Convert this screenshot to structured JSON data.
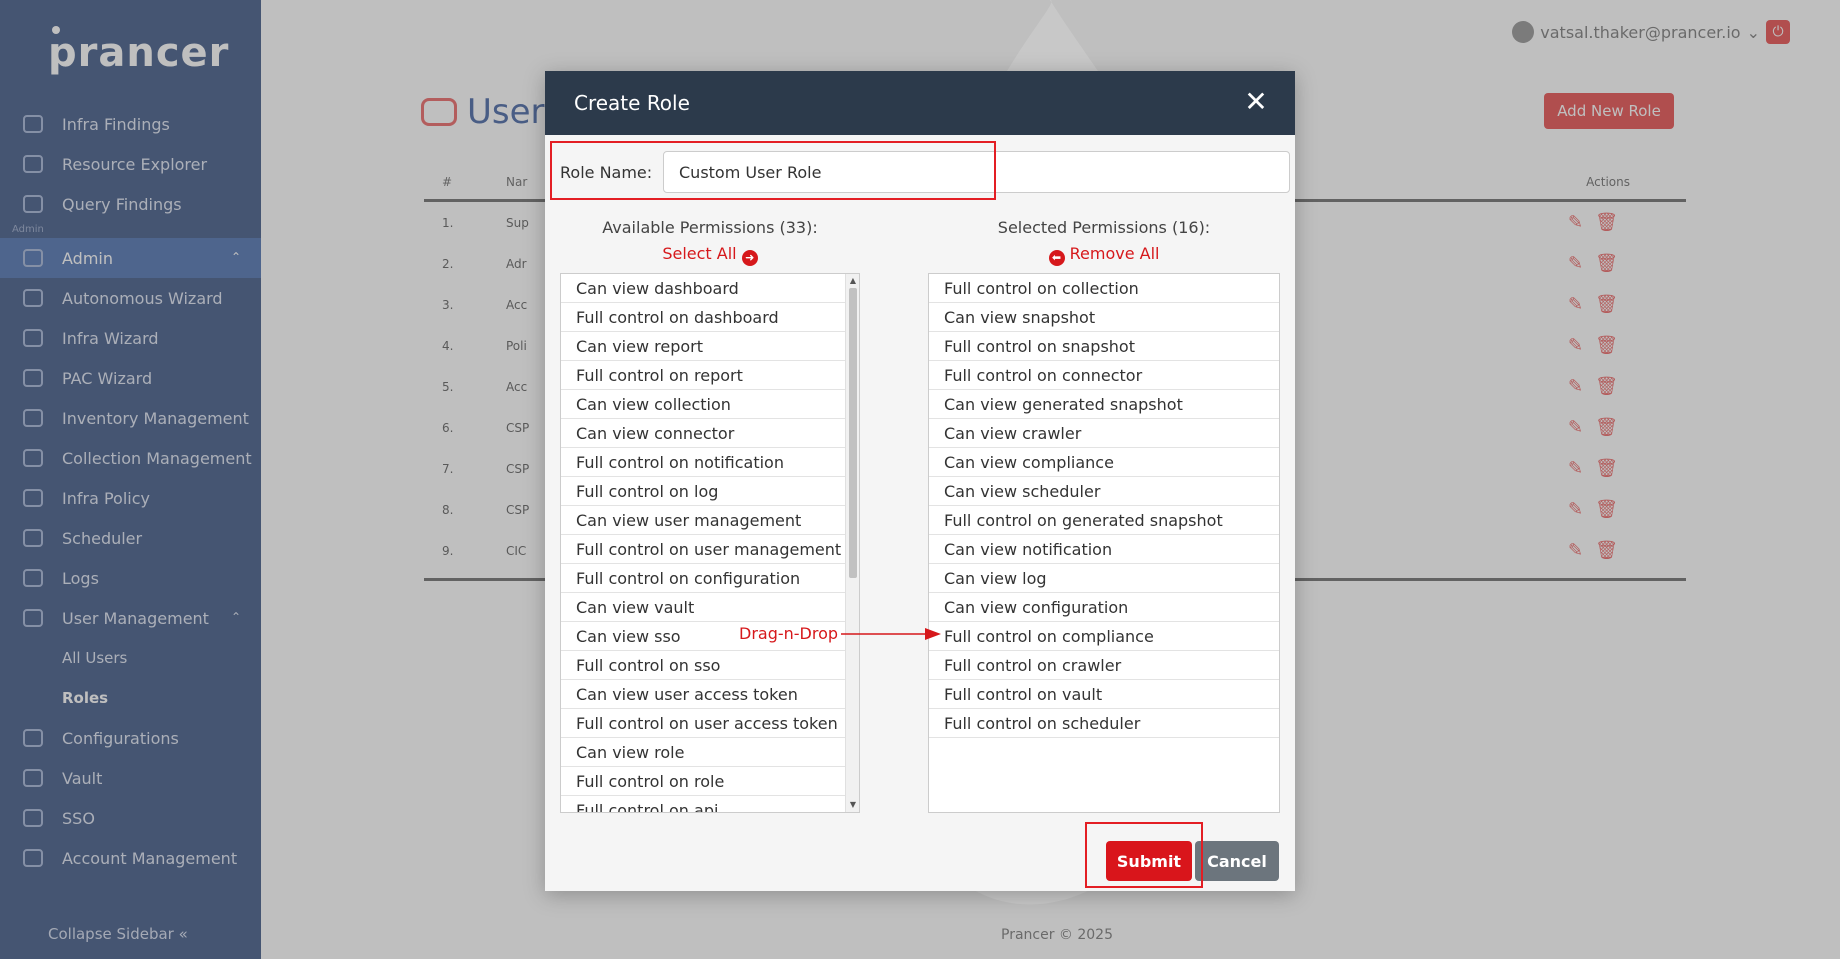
{
  "app": {
    "brand": "prancer",
    "footer": "Prancer © 2025"
  },
  "sidebar": {
    "items": [
      {
        "label": "Infra Findings",
        "icon": "infra-findings-icon"
      },
      {
        "label": "Resource Explorer",
        "icon": "resource-explorer-icon"
      },
      {
        "label": "Query Findings",
        "icon": "query-findings-icon"
      }
    ],
    "section_label": "Admin",
    "admin": {
      "label": "Admin",
      "icon": "admin-icon"
    },
    "admin_items": [
      {
        "label": "Autonomous Wizard",
        "icon": "autonomous-wizard-icon"
      },
      {
        "label": "Infra Wizard",
        "icon": "infra-wizard-icon"
      },
      {
        "label": "PAC Wizard",
        "icon": "pac-wizard-icon"
      },
      {
        "label": "Inventory Management",
        "icon": "inventory-icon"
      },
      {
        "label": "Collection Management",
        "icon": "collection-icon"
      },
      {
        "label": "Infra Policy",
        "icon": "infra-policy-icon"
      },
      {
        "label": "Scheduler",
        "icon": "scheduler-icon"
      },
      {
        "label": "Logs",
        "icon": "logs-icon"
      }
    ],
    "user_management": {
      "label": "User Management",
      "icon": "user-management-icon"
    },
    "user_management_sub": [
      "All Users",
      "Roles"
    ],
    "more_items": [
      {
        "label": "Configurations",
        "icon": "configurations-icon"
      },
      {
        "label": "Vault",
        "icon": "vault-icon"
      },
      {
        "label": "SSO",
        "icon": "sso-icon"
      },
      {
        "label": "Account Management",
        "icon": "account-management-icon"
      }
    ],
    "collapse_label": "Collapse Sidebar"
  },
  "header": {
    "user_email": "vatsal.thaker@prancer.io"
  },
  "page": {
    "title": "User",
    "add_button": "Add New Role",
    "table": {
      "headers": [
        "#",
        "Nar",
        "Actions"
      ],
      "rows": [
        {
          "num": "1.",
          "name": "Sup"
        },
        {
          "num": "2.",
          "name": "Adr"
        },
        {
          "num": "3.",
          "name": "Acc"
        },
        {
          "num": "4.",
          "name": "Poli"
        },
        {
          "num": "5.",
          "name": "Acc"
        },
        {
          "num": "6.",
          "name": "CSP"
        },
        {
          "num": "7.",
          "name": "CSP"
        },
        {
          "num": "8.",
          "name": "CSP"
        },
        {
          "num": "9.",
          "name": "CIC"
        }
      ]
    }
  },
  "modal": {
    "title": "Create Role",
    "role_name_label": "Role Name:",
    "role_name_value": "Custom User Role",
    "available": {
      "title": "Available Permissions (33):",
      "action": "Select All",
      "items": [
        "Can view dashboard",
        "Full control on dashboard",
        "Can view report",
        "Full control on report",
        "Can view collection",
        "Can view connector",
        "Full control on notification",
        "Full control on log",
        "Can view user management",
        "Full control on user management",
        "Full control on configuration",
        "Can view vault",
        "Can view sso",
        "Full control on sso",
        "Can view user access token",
        "Full control on user access token",
        "Can view role",
        "Full control on role",
        "Full control on api"
      ]
    },
    "selected": {
      "title": "Selected Permissions (16):",
      "action": "Remove All",
      "items": [
        "Full control on collection",
        "Can view snapshot",
        "Full control on snapshot",
        "Full control on connector",
        "Can view generated snapshot",
        "Can view crawler",
        "Can view compliance",
        "Can view scheduler",
        "Full control on generated snapshot",
        "Can view notification",
        "Can view log",
        "Can view configuration",
        "Full control on compliance",
        "Full control on crawler",
        "Full control on vault",
        "Full control on scheduler"
      ]
    },
    "annotation": "Drag-n-Drop",
    "submit": "Submit",
    "cancel": "Cancel"
  },
  "colors": {
    "sidebar_bg": "#0b2a64",
    "modal_header": "#2c3a4b",
    "accent_red": "#d9151b",
    "cancel_gray": "#6c757d",
    "highlight_box": "#e31e24"
  }
}
